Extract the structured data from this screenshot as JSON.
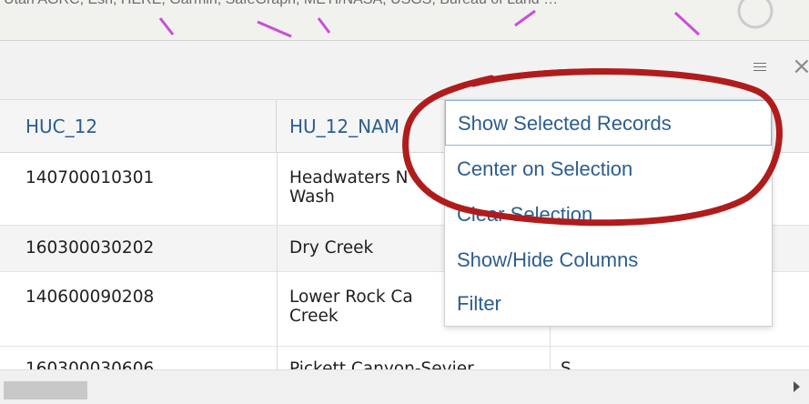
{
  "map": {
    "attribution": "Utah AGRC, Esri, HERE, Garmin, SafeGraph, METI/NASA, USGS, Bureau of Land …"
  },
  "toolbar": {
    "menu_icon": "hamburger-icon",
    "close_icon": "close-icon",
    "close_glyph": "×"
  },
  "table": {
    "columns": [
      "HUC_12",
      "HU_12_NAM"
    ],
    "rows": [
      {
        "huc": "140700010301",
        "name": "Headwaters N\nWash",
        "extra": ""
      },
      {
        "huc": "160300030202",
        "name": "Dry Creek",
        "extra": ""
      },
      {
        "huc": "140600090208",
        "name": "Lower Rock Ca\nCreek",
        "extra": ""
      },
      {
        "huc": "160300030606",
        "name": "Pickett Canyon-Sevier",
        "extra": "S"
      }
    ]
  },
  "menu": {
    "items": [
      "Show Selected Records",
      "Center on Selection",
      "Clear Selection",
      "Show/Hide Columns",
      "Filter"
    ]
  },
  "colors": {
    "link_blue": "#2c5d8f",
    "annotation_red": "#b01c1c",
    "map_route": "#c94fd6"
  }
}
